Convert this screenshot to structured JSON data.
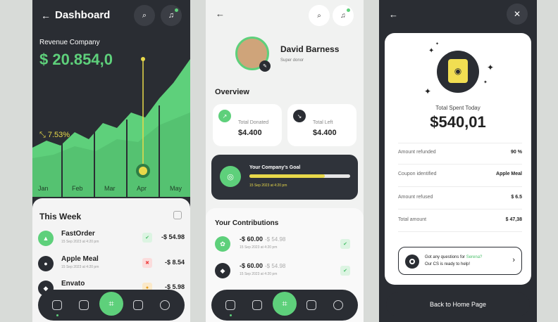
{
  "dashboard": {
    "title": "Dashboard",
    "back_icon": "arrow-left-icon",
    "revenue_label": "Revenue Company",
    "revenue_value": "$ 20.854,0",
    "growth": "7.53%",
    "months": [
      "Jan",
      "Feb",
      "Mar",
      "Apr",
      "May"
    ],
    "this_week": "This Week",
    "transactions": [
      {
        "name": "FastOrder",
        "date": "15 Sep 2023 at 4:20 pm",
        "amount": "-$ 54.98",
        "status": "success",
        "icon": "burger-icon"
      },
      {
        "name": "Apple Meal",
        "date": "15 Sep 2023 at 4:20 pm",
        "amount": "-$ 8.54",
        "status": "failed",
        "icon": "apple-icon"
      },
      {
        "name": "Envato",
        "date": "",
        "amount": "-$ 5.98",
        "status": "pending",
        "icon": "leaf-icon"
      }
    ]
  },
  "profile": {
    "name": "David Barness",
    "role": "Super donor",
    "overview": "Overview",
    "total_donated_label": "Total Donated",
    "total_donated": "$4.400",
    "total_left_label": "Total Left",
    "total_left": "$4.400",
    "goal_title": "Your Company's Goal",
    "goal_date": "15 Sep 2023 at 4:20 pm",
    "goal_progress": 0.75,
    "contributions_title": "Your Contributions",
    "contributions": [
      {
        "amount": "-$ 60.00",
        "old": "-$ 54.98",
        "date": "15 Sep 2023 at 4:20 pm"
      },
      {
        "amount": "-$ 60.00",
        "old": "-$ 54.98",
        "date": "15 Sep 2023 at 4:20 pm"
      }
    ]
  },
  "receipt": {
    "total_label": "Total Spent Today",
    "total_value": "$540,01",
    "rows": [
      {
        "label": "Amount refunded",
        "value": "90 %"
      },
      {
        "label": "Coupon identified",
        "value": "Apple Meal"
      },
      {
        "label": "Amount refused",
        "value": "$ 6.5"
      },
      {
        "label": "Total amount",
        "value": "$ 47,38"
      }
    ],
    "help_line1": "Got any questions for ",
    "help_name": "Serena?",
    "help_line2": "Our CS is ready to help!",
    "cta": "Back to Home Page"
  },
  "colors": {
    "accent": "#5ed07b",
    "dark": "#2a2d33",
    "yellow": "#e8d94a"
  }
}
